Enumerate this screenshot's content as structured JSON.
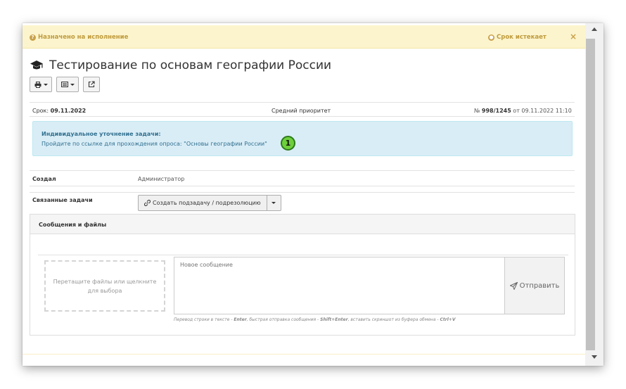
{
  "alert": {
    "left_text": "Назначено на исполнение",
    "right_text": "Срок истекает",
    "close": "×"
  },
  "title": "Тестирование по основам географии России",
  "meta": {
    "deadline_label": "Срок: ",
    "deadline_value": "09.11.2022",
    "priority": "Средний приоритет",
    "number_prefix": "№ ",
    "number_value": "998/1245",
    "number_suffix": " от 09.11.2022 11:10"
  },
  "info": {
    "title": "Индивидуальное уточнение задачи:",
    "text": "Пройдите по ссылке для прохождения опроса: \"Основы географии России\"",
    "marker": "1"
  },
  "fields": {
    "created_label": "Создал",
    "created_value": "Администратор",
    "related_label": "Связанные задачи",
    "create_subtask_button": "Создать подзадачу / подрезолюцию"
  },
  "messages": {
    "panel_title": "Сообщения и файлы",
    "dropzone_text": "Перетащите файлы или щелкните для выбора",
    "message_placeholder": "Новое сообщение",
    "send_button": "Отправить",
    "hint_1": "Перевод строки в тексте - ",
    "hint_key_1": "Enter",
    "hint_2": ", быстрая отправка сообщения - ",
    "hint_key_2": "Shift+Enter",
    "hint_3": ", вставить скриншот из буфера обмена - ",
    "hint_key_3": "Ctrl+V"
  },
  "colors": {
    "alert_bg": "#fcf4cc",
    "alert_text": "#bf9b3c",
    "info_bg": "#d9edf7",
    "info_text": "#31708f",
    "marker_green": "#6ecf3c"
  },
  "icons": [
    "question-circle-icon",
    "clock-icon",
    "graduation-cap-icon",
    "print-icon",
    "list-icon",
    "external-link-icon",
    "link-icon",
    "send-icon"
  ]
}
